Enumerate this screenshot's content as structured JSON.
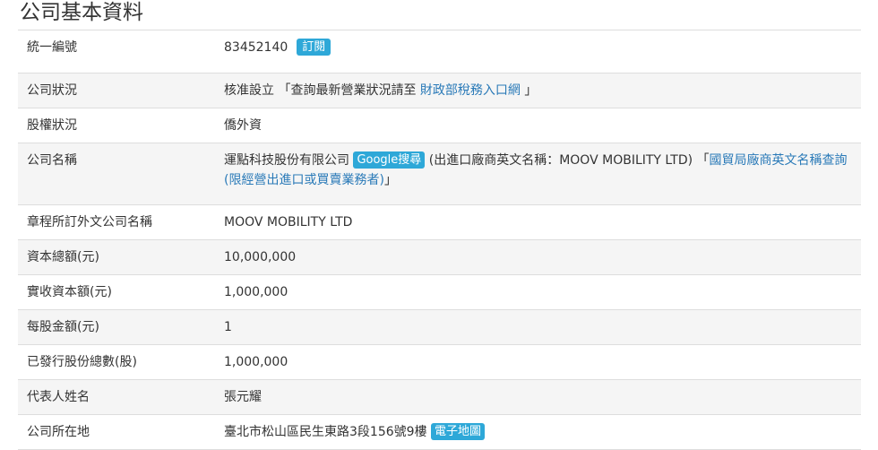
{
  "page_title": "公司基本資料",
  "rows": {
    "tax_id": {
      "label": "統一編號",
      "value": "83452140",
      "subscribe": "訂閱"
    },
    "status": {
      "label": "公司狀況",
      "value": "核准設立",
      "open_quote": "「查詢最新營業狀況請至",
      "link": "財政部稅務入口網",
      "close_quote": "」"
    },
    "equity": {
      "label": "股權狀況",
      "value": "僑外資"
    },
    "name": {
      "label": "公司名稱",
      "value": "運點科技股份有限公司",
      "google": "Google搜尋",
      "english_note": "(出進口廠商英文名稱：MOOV MOBILITY LTD) 「",
      "link": "國貿局廠商英文名稱查詢(限經營出進口或買賣業務者)",
      "close_quote": "」"
    },
    "foreign_name": {
      "label": "章程所訂外文公司名稱",
      "value": "MOOV MOBILITY LTD"
    },
    "capital": {
      "label": "資本總額(元)",
      "value": "10,000,000"
    },
    "paid_capital": {
      "label": "實收資本額(元)",
      "value": "1,000,000"
    },
    "par_value": {
      "label": "每股金額(元)",
      "value": "1"
    },
    "shares": {
      "label": "已發行股份總數(股)",
      "value": "1,000,000"
    },
    "representative": {
      "label": "代表人姓名",
      "value": "張元耀"
    },
    "address": {
      "label": "公司所在地",
      "value": "臺北市松山區民生東路3段156號9樓",
      "map": "電子地圖"
    }
  }
}
